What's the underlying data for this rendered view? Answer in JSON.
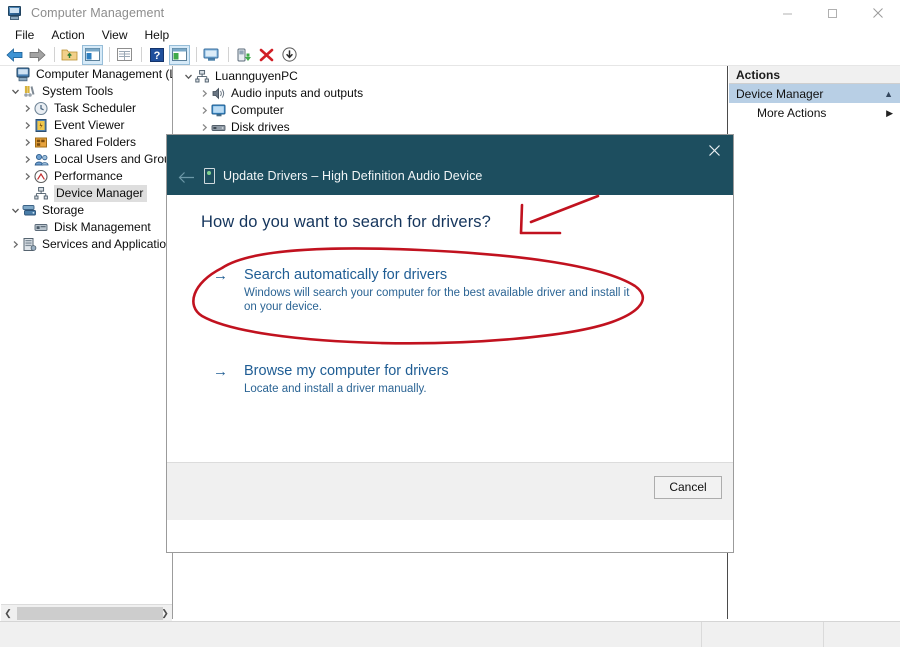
{
  "window": {
    "title": "Computer Management",
    "icon": "computer-management-icon",
    "controls": {
      "minimize": "Minimize",
      "maximize": "Maximize",
      "close": "Close"
    }
  },
  "menubar": {
    "items": [
      {
        "label": "File"
      },
      {
        "label": "Action"
      },
      {
        "label": "View"
      },
      {
        "label": "Help"
      }
    ]
  },
  "toolbar": {
    "items": [
      {
        "name": "back-icon"
      },
      {
        "name": "forward-icon"
      },
      {
        "name": "separator"
      },
      {
        "name": "up-folder-icon"
      },
      {
        "name": "show-hide-console-tree-icon"
      },
      {
        "name": "separator"
      },
      {
        "name": "properties-icon"
      },
      {
        "name": "separator"
      },
      {
        "name": "help-icon"
      },
      {
        "name": "show-hide-action-pane-icon"
      },
      {
        "name": "separator"
      },
      {
        "name": "scan-hardware-changes-icon"
      },
      {
        "name": "separator"
      },
      {
        "name": "update-driver-icon"
      },
      {
        "name": "uninstall-device-icon"
      },
      {
        "name": "disable-device-icon"
      }
    ]
  },
  "console_tree": {
    "root": "Computer Management (Local",
    "items": [
      {
        "label": "Computer Management (Local",
        "indent": 0,
        "expander": "none",
        "icon": "computer-management-icon",
        "selected": false
      },
      {
        "label": "System Tools",
        "indent": 1,
        "expander": "expanded",
        "icon": "system-tools-icon",
        "selected": false
      },
      {
        "label": "Task Scheduler",
        "indent": 2,
        "expander": "collapsed",
        "icon": "task-scheduler-icon",
        "selected": false
      },
      {
        "label": "Event Viewer",
        "indent": 2,
        "expander": "collapsed",
        "icon": "event-viewer-icon",
        "selected": false
      },
      {
        "label": "Shared Folders",
        "indent": 2,
        "expander": "collapsed",
        "icon": "shared-folders-icon",
        "selected": false
      },
      {
        "label": "Local Users and Groups",
        "indent": 2,
        "expander": "collapsed",
        "icon": "local-users-icon",
        "selected": false
      },
      {
        "label": "Performance",
        "indent": 2,
        "expander": "collapsed",
        "icon": "performance-icon",
        "selected": false
      },
      {
        "label": "Device Manager",
        "indent": 2,
        "expander": "none",
        "icon": "device-manager-icon",
        "selected": true
      },
      {
        "label": "Storage",
        "indent": 1,
        "expander": "expanded",
        "icon": "storage-icon",
        "selected": false
      },
      {
        "label": "Disk Management",
        "indent": 2,
        "expander": "none",
        "icon": "disk-management-icon",
        "selected": false
      },
      {
        "label": "Services and Applications",
        "indent": 1,
        "expander": "collapsed",
        "icon": "services-icon",
        "selected": false
      }
    ]
  },
  "device_tree": {
    "items": [
      {
        "label": "LuannguyenPC",
        "indent": 0,
        "expander": "expanded",
        "icon": "computer-node-icon"
      },
      {
        "label": "Audio inputs and outputs",
        "indent": 1,
        "expander": "collapsed",
        "icon": "audio-icon"
      },
      {
        "label": "Computer",
        "indent": 1,
        "expander": "collapsed",
        "icon": "monitor-icon"
      },
      {
        "label": "Disk drives",
        "indent": 1,
        "expander": "collapsed",
        "icon": "disk-drive-icon"
      }
    ]
  },
  "actions_pane": {
    "header": "Actions",
    "group": "Device Manager",
    "group_caret": "collapse-caret-icon",
    "items": [
      {
        "label": "More Actions",
        "submenu_icon": "submenu-arrow-icon"
      }
    ]
  },
  "dialog": {
    "title": "Update Drivers – High Definition Audio Device",
    "title_icon": "device-icon",
    "back_icon": "back-arrow-icon",
    "close_icon": "close-icon",
    "question": "How do you want to search for drivers?",
    "options": [
      {
        "arrow": "→",
        "title": "Search automatically for drivers",
        "desc": "Windows will search your computer for the best available driver and install it on your device."
      },
      {
        "arrow": "→",
        "title": "Browse my computer for drivers",
        "desc": "Locate and install a driver manually."
      }
    ],
    "cancel_label": "Cancel"
  },
  "scrollbar": {
    "left_arrow": "scroll-left-icon",
    "right_arrow": "scroll-right-icon"
  },
  "annotations": {
    "color": "#c1121f",
    "shapes": [
      {
        "name": "ellipse-highlight-search-automatically"
      },
      {
        "name": "arrow-pointing-up-right"
      }
    ]
  },
  "colors": {
    "dialog_header": "#1d4e5f",
    "link_blue": "#1f5d94",
    "heading_navy": "#15355c",
    "actions_group_bg": "#b8cfe5",
    "annotation_red": "#c1121f"
  }
}
